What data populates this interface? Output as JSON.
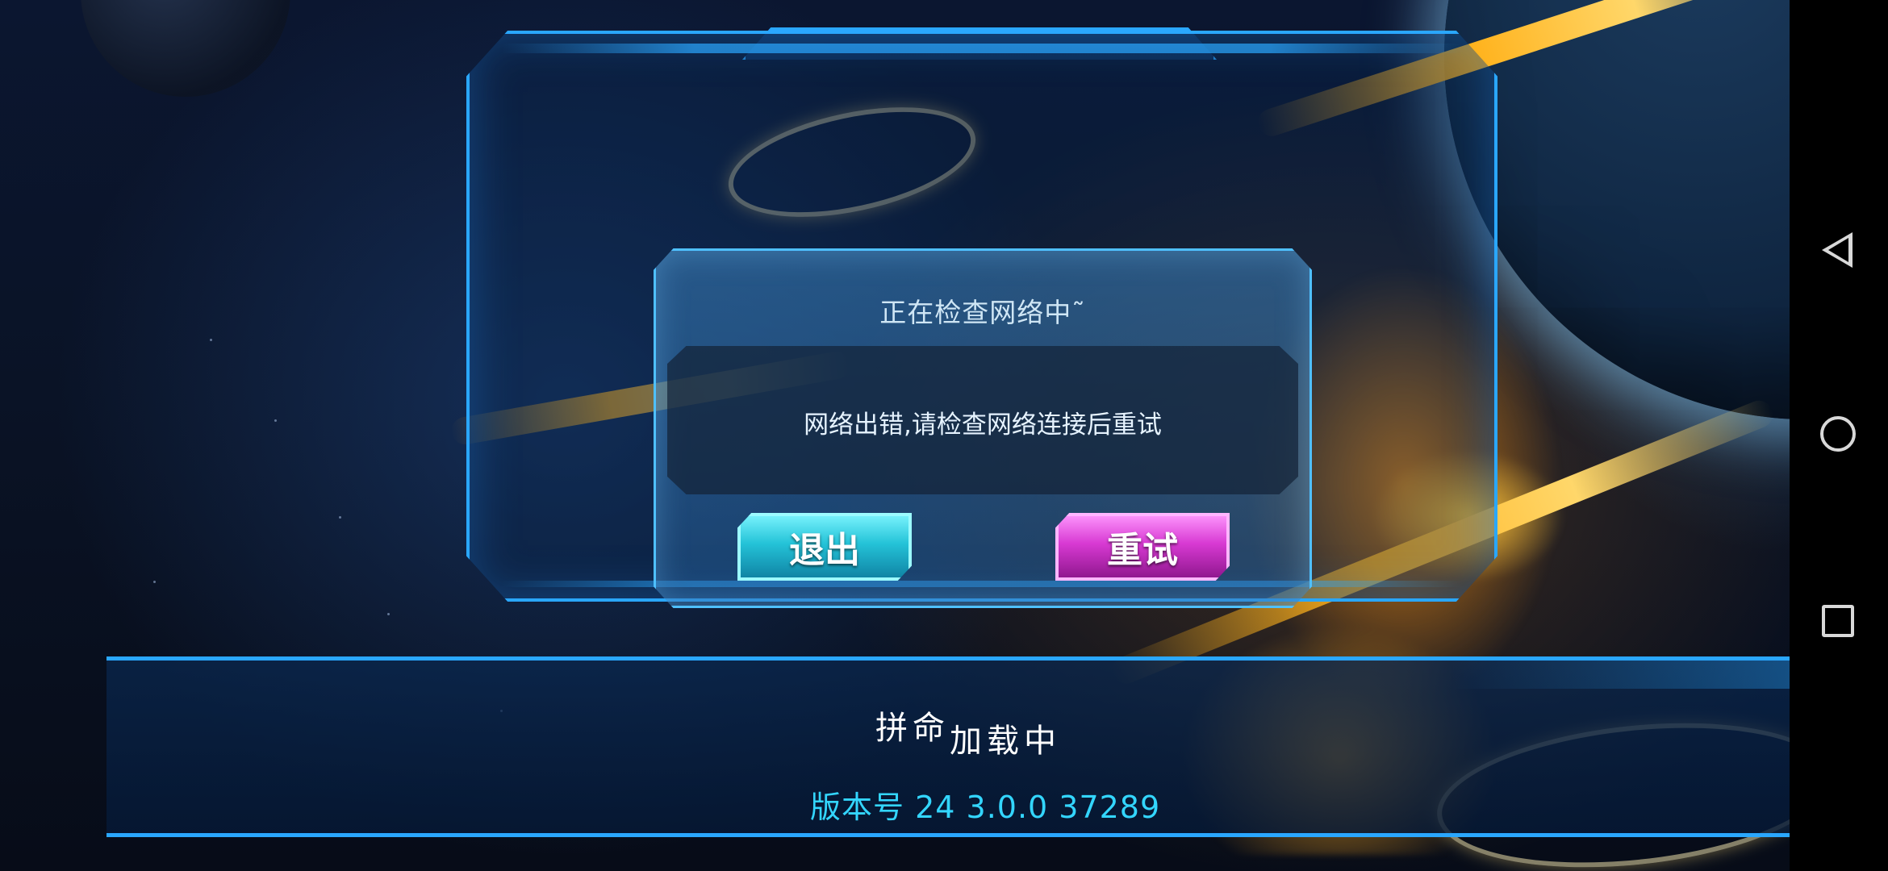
{
  "dialog": {
    "title": "正在检查网络中˜",
    "message": "网络出错,请检查网络连接后重试",
    "exit_label": "退出",
    "retry_label": "重试"
  },
  "loading": {
    "text_part1": "拼命",
    "text_part2": "加载中",
    "version": "版本号 24 3.0.0 37289"
  },
  "colors": {
    "frame_accent": "#2aa7ff",
    "exit_button": "#24c3d8",
    "retry_button": "#d83ad3",
    "version_text": "#33d6ff"
  },
  "navbar": {
    "icons": [
      "back-icon",
      "home-icon",
      "recent-apps-icon"
    ]
  }
}
